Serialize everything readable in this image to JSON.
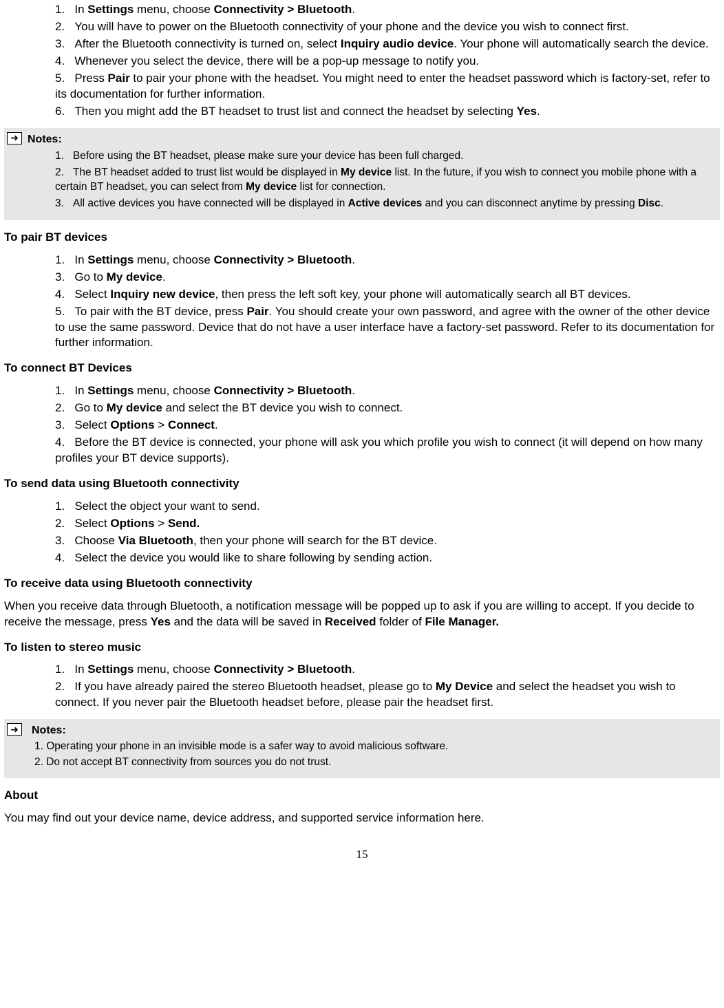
{
  "list1": {
    "i1": {
      "n": "1.",
      "pre": "In ",
      "b1": "Settings",
      "mid": " menu, choose ",
      "b2": "Connectivity > Bluetooth",
      "post": "."
    },
    "i2": {
      "n": "2.",
      "t": "You will have to power on the Bluetooth connectivity of your phone and the device you wish to connect first."
    },
    "i3": {
      "n": "3.",
      "pre": "After the Bluetooth connectivity is turned on, select ",
      "b1": "Inquiry audio device",
      "post": ". Your phone will automatically search the device."
    },
    "i4": {
      "n": "4.",
      "t": "Whenever you select the device, there will be a pop-up message to notify you."
    },
    "i5": {
      "n": "5.",
      "pre": "Press ",
      "b1": "Pair",
      "post": " to pair your phone with the headset. You might need to enter the headset password which is factory-set, refer to its documentation for further information."
    },
    "i6": {
      "n": "6.",
      "pre": "Then you might add the BT headset to trust list and connect the headset by selecting ",
      "b1": "Yes",
      "post": "."
    }
  },
  "notes1": {
    "title": "Notes:",
    "i1": {
      "n": "1.",
      "t": "Before using the BT headset, please make sure your device has been full charged."
    },
    "i2": {
      "n": "2.",
      "pre": "The BT headset added to trust list would be displayed in ",
      "b1": "My device",
      "mid": " list. In the future, if you wish to connect you mobile phone with a certain BT headset, you can select from ",
      "b2": "My device",
      "post": " list for connection."
    },
    "i3": {
      "n": "3.",
      "pre": "All active devices you have connected will be displayed in ",
      "b1": "Active devices",
      "mid": " and you can disconnect anytime by pressing ",
      "b2": "Disc",
      "post": "."
    }
  },
  "h_pair": "To pair BT devices",
  "list2": {
    "i1": {
      "n": "1.",
      "pre": "In ",
      "b1": "Settings",
      "mid": " menu, choose ",
      "b2": "Connectivity > Bluetooth",
      "post": "."
    },
    "i3": {
      "n": "3.",
      "pre": "Go to ",
      "b1": "My device",
      "post": "."
    },
    "i4": {
      "n": "4.",
      "pre": "Select ",
      "b1": "Inquiry new device",
      "post": ", then press the left soft key, your phone will automatically search all BT devices."
    },
    "i5": {
      "n": "5.",
      "pre": "To pair with the BT device, press ",
      "b1": "Pair",
      "post": ". You should create your own password, and agree with the owner of the other device to use the same password. Device that do not have a user interface have a factory-set password. Refer to its documentation for further information."
    }
  },
  "h_connect": "To connect BT Devices",
  "list3": {
    "i1": {
      "n": "1.",
      "pre": "In ",
      "b1": "Settings",
      "mid": " menu, choose ",
      "b2": "Connectivity > Bluetooth",
      "post": "."
    },
    "i2": {
      "n": "2.",
      "pre": "Go to ",
      "b1": "My device",
      "post": " and select the BT device you wish to connect."
    },
    "i3": {
      "n": "3.",
      "pre": "Select ",
      "b1": "Options",
      "mid": " > ",
      "b2": "Connect",
      "post": "."
    },
    "i4": {
      "n": "4.",
      "t": "Before the BT device is connected, your phone will ask you which profile you wish to connect (it will depend on how many profiles your BT device supports)."
    }
  },
  "h_send": "To send data using Bluetooth connectivity",
  "list4": {
    "i1": {
      "n": "1.",
      "t": "Select the object your want to send."
    },
    "i2": {
      "n": "2.",
      "pre": "Select ",
      "b1": "Options",
      "mid": " > ",
      "b2": "Send.",
      "post": ""
    },
    "i3": {
      "n": "3.",
      "pre": "Choose ",
      "b1": "Via Bluetooth",
      "post": ", then your phone will search for the BT device."
    },
    "i4": {
      "n": "4.",
      "t": "Select the device you would like to share following by sending action."
    }
  },
  "h_receive": "To receive data using Bluetooth connectivity",
  "para_receive": {
    "pre": "When you receive data through Bluetooth, a notification message will be popped up to ask if you are willing to accept. If you decide to receive the message, press ",
    "b1": "Yes",
    "mid": " and the data will be saved in ",
    "b2": "Received",
    "mid2": " folder of ",
    "b3": "File Manager.",
    "post": ""
  },
  "h_stereo": "To listen to stereo music",
  "list5": {
    "i1": {
      "n": "1.",
      "pre": "In ",
      "b1": "Settings",
      "mid": " menu, choose ",
      "b2": "Connectivity > Bluetooth",
      "post": "."
    },
    "i2": {
      "n": "2.",
      "pre": "If you have already paired the stereo Bluetooth headset, please go to ",
      "b1": "My Device",
      "post": " and select the headset you wish to connect. If you never pair the Bluetooth headset before, please pair the headset first."
    }
  },
  "notes2": {
    "title": "Notes:",
    "l1": "1. Operating your phone in an invisible mode is a safer way to avoid malicious software.",
    "l2": "2. Do not accept BT connectivity from sources you do not trust."
  },
  "h_about": "About",
  "para_about": "You may find out your device name, device address, and supported service information here.",
  "page": "15"
}
